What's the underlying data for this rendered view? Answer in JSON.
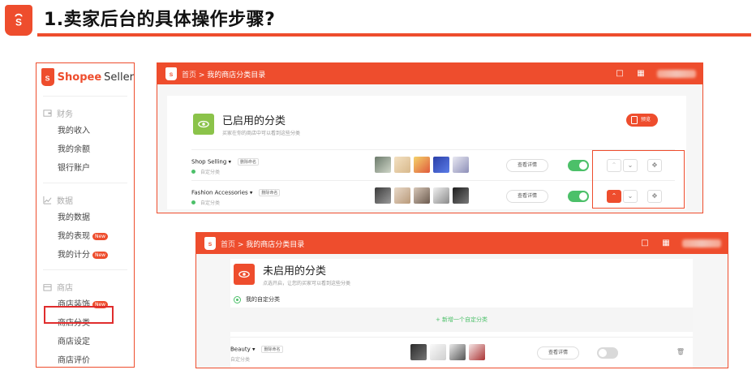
{
  "slide": {
    "title": "1.卖家后台的具体操作步骤?",
    "accent": "#ee4d2d"
  },
  "sidebar": {
    "brand": "Shopee",
    "brand_suffix": "Seller",
    "groups": [
      {
        "label": "财务",
        "icon": "wallet-icon",
        "items": [
          {
            "label": "我的收入"
          },
          {
            "label": "我的余额"
          },
          {
            "label": "银行账户"
          }
        ]
      },
      {
        "label": "数据",
        "icon": "chart-icon",
        "items": [
          {
            "label": "我的数据"
          },
          {
            "label": "我的表现",
            "badge": "New"
          },
          {
            "label": "我的计分",
            "badge": "New"
          }
        ]
      },
      {
        "label": "商店",
        "icon": "store-icon",
        "items": [
          {
            "label": "商店装饰",
            "badge": "New"
          },
          {
            "label": "商店分类"
          },
          {
            "label": "商店设定"
          },
          {
            "label": "商店评价"
          }
        ]
      }
    ]
  },
  "screen1": {
    "breadcrumb_home": "首页",
    "breadcrumb_page": "我的商店分类目录",
    "section_title": "已启用的分类",
    "section_subtitle": "买家在你的商店中可以看到这些分类",
    "preview_label": "预览",
    "rows": [
      {
        "name": "Shop Selling",
        "tag": "删除命名",
        "status": "自定分类",
        "detail": "查看详情",
        "enabled": true
      },
      {
        "name": "Fashion Accessories",
        "tag": "删除命名",
        "status": "自定分类",
        "detail": "查看详情",
        "enabled": true
      }
    ]
  },
  "screen2": {
    "breadcrumb_home": "首页",
    "breadcrumb_page": "我的商店分类目录",
    "section_title": "未启用的分类",
    "section_subtitle": "点选开启，让您的买家可以看到这些分类",
    "my_category": "我的自定分类",
    "add_label": "新增一个自定分类",
    "rows": [
      {
        "name": "Beauty",
        "tag": "删除命名",
        "status": "自定分类",
        "detail": "查看详情",
        "enabled": false
      }
    ]
  }
}
